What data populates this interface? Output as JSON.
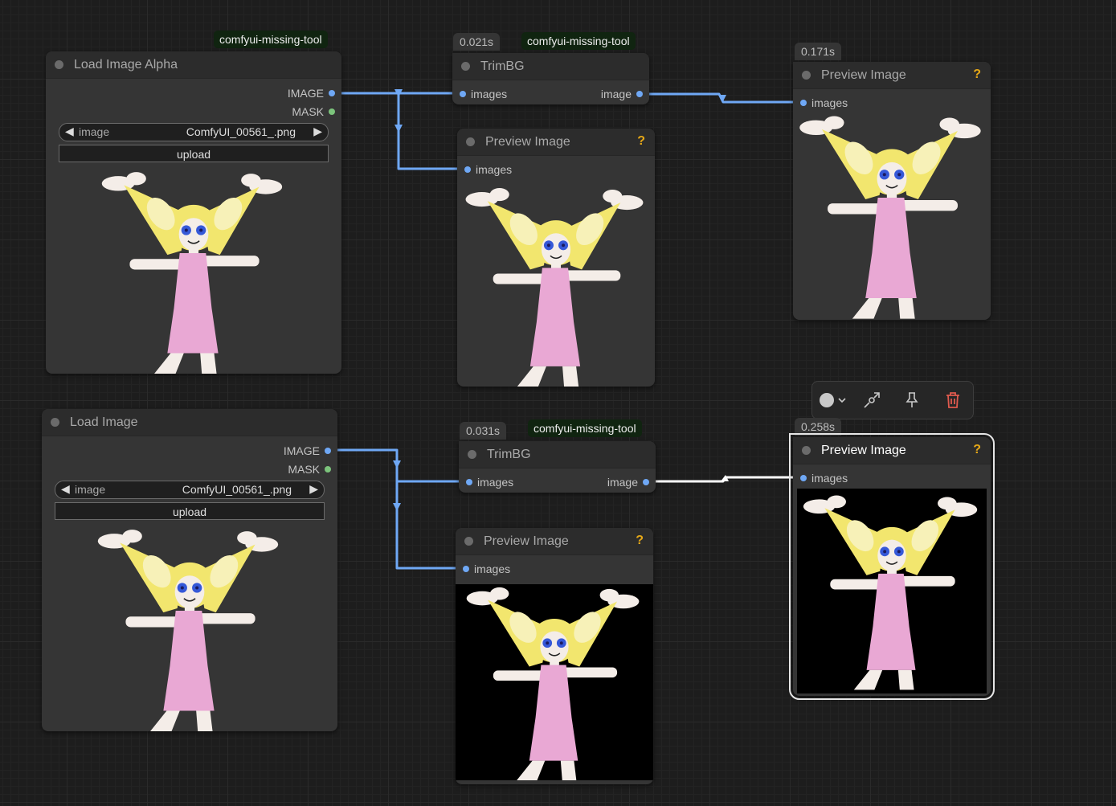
{
  "nodes": {
    "load_alpha": {
      "title": "Load Image Alpha",
      "badge": "comfyui-missing-tool",
      "outputs": [
        "IMAGE",
        "MASK"
      ],
      "combo_label": "image",
      "combo_value": "ComfyUI_00561_.png",
      "upload_label": "upload"
    },
    "trim_top": {
      "title": "TrimBG",
      "time": "0.021s",
      "badge": "comfyui-missing-tool",
      "input": "images",
      "output": "image"
    },
    "preview_mid_top": {
      "title": "Preview Image",
      "help": "?",
      "input": "images"
    },
    "preview_right_top": {
      "title": "Preview Image",
      "time": "0.171s",
      "help": "?",
      "input": "images"
    },
    "load_image": {
      "title": "Load Image",
      "outputs": [
        "IMAGE",
        "MASK"
      ],
      "combo_label": "image",
      "combo_value": "ComfyUI_00561_.png",
      "upload_label": "upload"
    },
    "trim_bottom": {
      "title": "TrimBG",
      "time": "0.031s",
      "badge": "comfyui-missing-tool",
      "input": "images",
      "output": "image"
    },
    "preview_mid_bottom": {
      "title": "Preview Image",
      "help": "?",
      "input": "images"
    },
    "preview_right_bottom": {
      "title": "Preview Image",
      "time": "0.258s",
      "help": "?",
      "input": "images"
    }
  },
  "toolbar": {
    "icons": [
      "color-circle-icon",
      "chevron-down-icon",
      "bypass-icon",
      "pin-icon",
      "trash-icon"
    ]
  },
  "colors": {
    "wire_image": "#6fa8f5",
    "wire_selected": "#ffffff",
    "help": "#e6a817",
    "trash": "#e05a4e"
  }
}
